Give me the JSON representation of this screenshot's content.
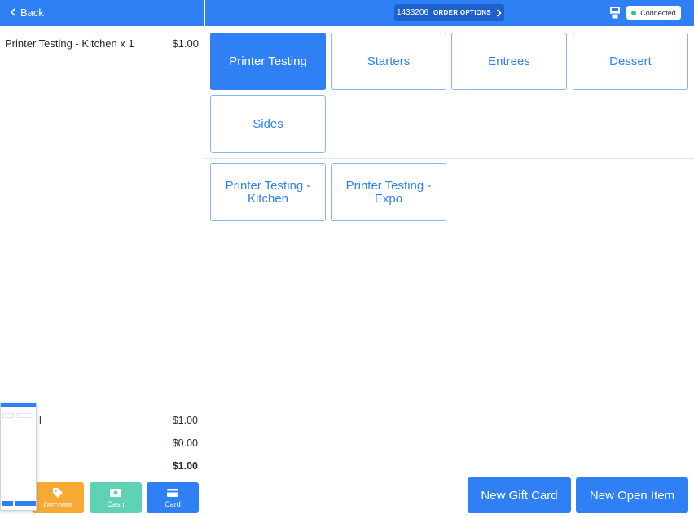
{
  "left": {
    "back_label": "Back",
    "order_line": {
      "name": "Printer Testing - Kitchen x 1",
      "price": "$1.00"
    },
    "totals": [
      {
        "label": "l",
        "value": "$1.00",
        "bold": false
      },
      {
        "label": "",
        "value": "$0.00",
        "bold": false
      },
      {
        "label": "",
        "value": "$1.00",
        "bold": true
      }
    ],
    "payment_buttons": [
      {
        "label": "Discount",
        "icon": "tag-icon",
        "color": "#f7a934"
      },
      {
        "label": "Cash",
        "icon": "cash-icon",
        "color": "#5fd1b5"
      },
      {
        "label": "Card",
        "icon": "card-icon",
        "color": "#2f80f5"
      }
    ]
  },
  "header": {
    "order_id": "1433206",
    "order_options_label": "ORDER OPTIONS",
    "connection_status": "Connected",
    "status_color": "#34c48b"
  },
  "categories": [
    "Printer Testing",
    "Starters",
    "Entrees",
    "Dessert",
    "Sides"
  ],
  "active_category": "Printer Testing",
  "items": [
    "Printer Testing - Kitchen",
    "Printer Testing - Expo"
  ],
  "bottom_buttons": [
    "New Gift Card",
    "New Open Item"
  ],
  "colors": {
    "accent": "#2f80f5",
    "accent_dark": "#1f5fc9",
    "discount": "#f7a934",
    "cash": "#5fd1b5"
  }
}
